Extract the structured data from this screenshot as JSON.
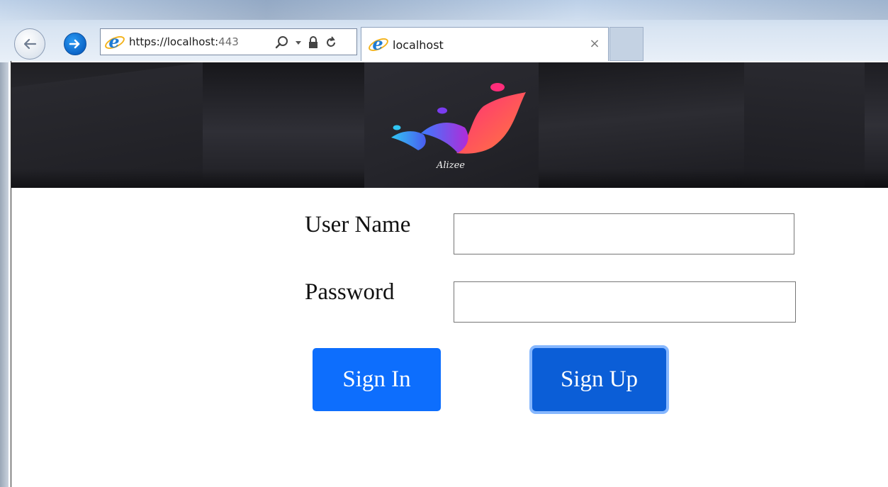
{
  "browser": {
    "url_main": "https://localhost:",
    "url_port": "443",
    "tab_title": "localhost",
    "close_glyph": "×",
    "icons": {
      "back": "back-arrow-icon",
      "forward": "forward-arrow-icon",
      "site": "internet-explorer-icon",
      "search": "search-icon",
      "dropdown": "dropdown-caret-icon",
      "lock": "lock-icon",
      "refresh": "refresh-icon"
    },
    "accent_color": "#0a62c5"
  },
  "banner": {
    "logo_text": "Alizee",
    "logo_colors": [
      "#ff2d7a",
      "#8a2be2",
      "#31c6f2"
    ]
  },
  "login": {
    "username_label": "User Name",
    "username_value": "",
    "password_label": "Password",
    "password_value": "",
    "signin_label": "Sign In",
    "signup_label": "Sign Up",
    "primary_color": "#0d6efd"
  }
}
